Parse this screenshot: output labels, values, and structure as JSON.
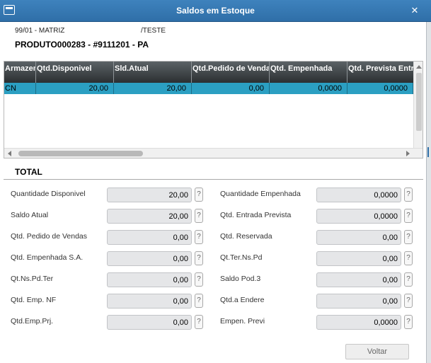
{
  "window": {
    "title": "Saldos em Estoque",
    "close_glyph": "✕"
  },
  "header": {
    "branch": "99/01 - MATRIZ",
    "user": "/TESTE",
    "product": "PRODUTO000283 - #9111201 - PA"
  },
  "grid": {
    "columns": [
      "Armazem",
      "Qtd.Disponivel",
      "Sld.Atual",
      "Qtd.Pedido de Vendas",
      "Qtd. Empenhada",
      "Qtd. Prevista Entrada"
    ],
    "rows": [
      [
        "CN",
        "20,00",
        "20,00",
        "0,00",
        "0,0000",
        "0,0000"
      ]
    ],
    "selected_row_color": "#2b9fc2",
    "header_color": "#3a3f42"
  },
  "total": {
    "title": "TOTAL",
    "help_glyph": "?",
    "left_fields": [
      {
        "label": "Quantidade Disponivel",
        "value": "20,00"
      },
      {
        "label": "Saldo Atual",
        "value": "20,00"
      },
      {
        "label": "Qtd. Pedido de Vendas",
        "value": "0,00"
      },
      {
        "label": "Qtd. Empenhada S.A.",
        "value": "0,00"
      },
      {
        "label": "Qt.Ns.Pd.Ter",
        "value": "0,00"
      },
      {
        "label": "Qtd. Emp. NF",
        "value": "0,00"
      },
      {
        "label": "Qtd.Emp.Prj.",
        "value": "0,00"
      }
    ],
    "right_fields": [
      {
        "label": "Quantidade Empenhada",
        "value": "0,0000"
      },
      {
        "label": "Qtd. Entrada Prevista",
        "value": "0,0000"
      },
      {
        "label": "Qtd. Reservada",
        "value": "0,00"
      },
      {
        "label": "Qt.Ter.Ns.Pd",
        "value": "0,00"
      },
      {
        "label": "Saldo Pod.3",
        "value": "0,00"
      },
      {
        "label": "Qtd.a Endere",
        "value": "0,00"
      },
      {
        "label": "Empen. Previ",
        "value": "0,0000"
      }
    ]
  },
  "footer": {
    "voltar_label": "Voltar"
  },
  "colors": {
    "titlebar": "#3479b5",
    "field_bg": "#e5e6e8"
  }
}
